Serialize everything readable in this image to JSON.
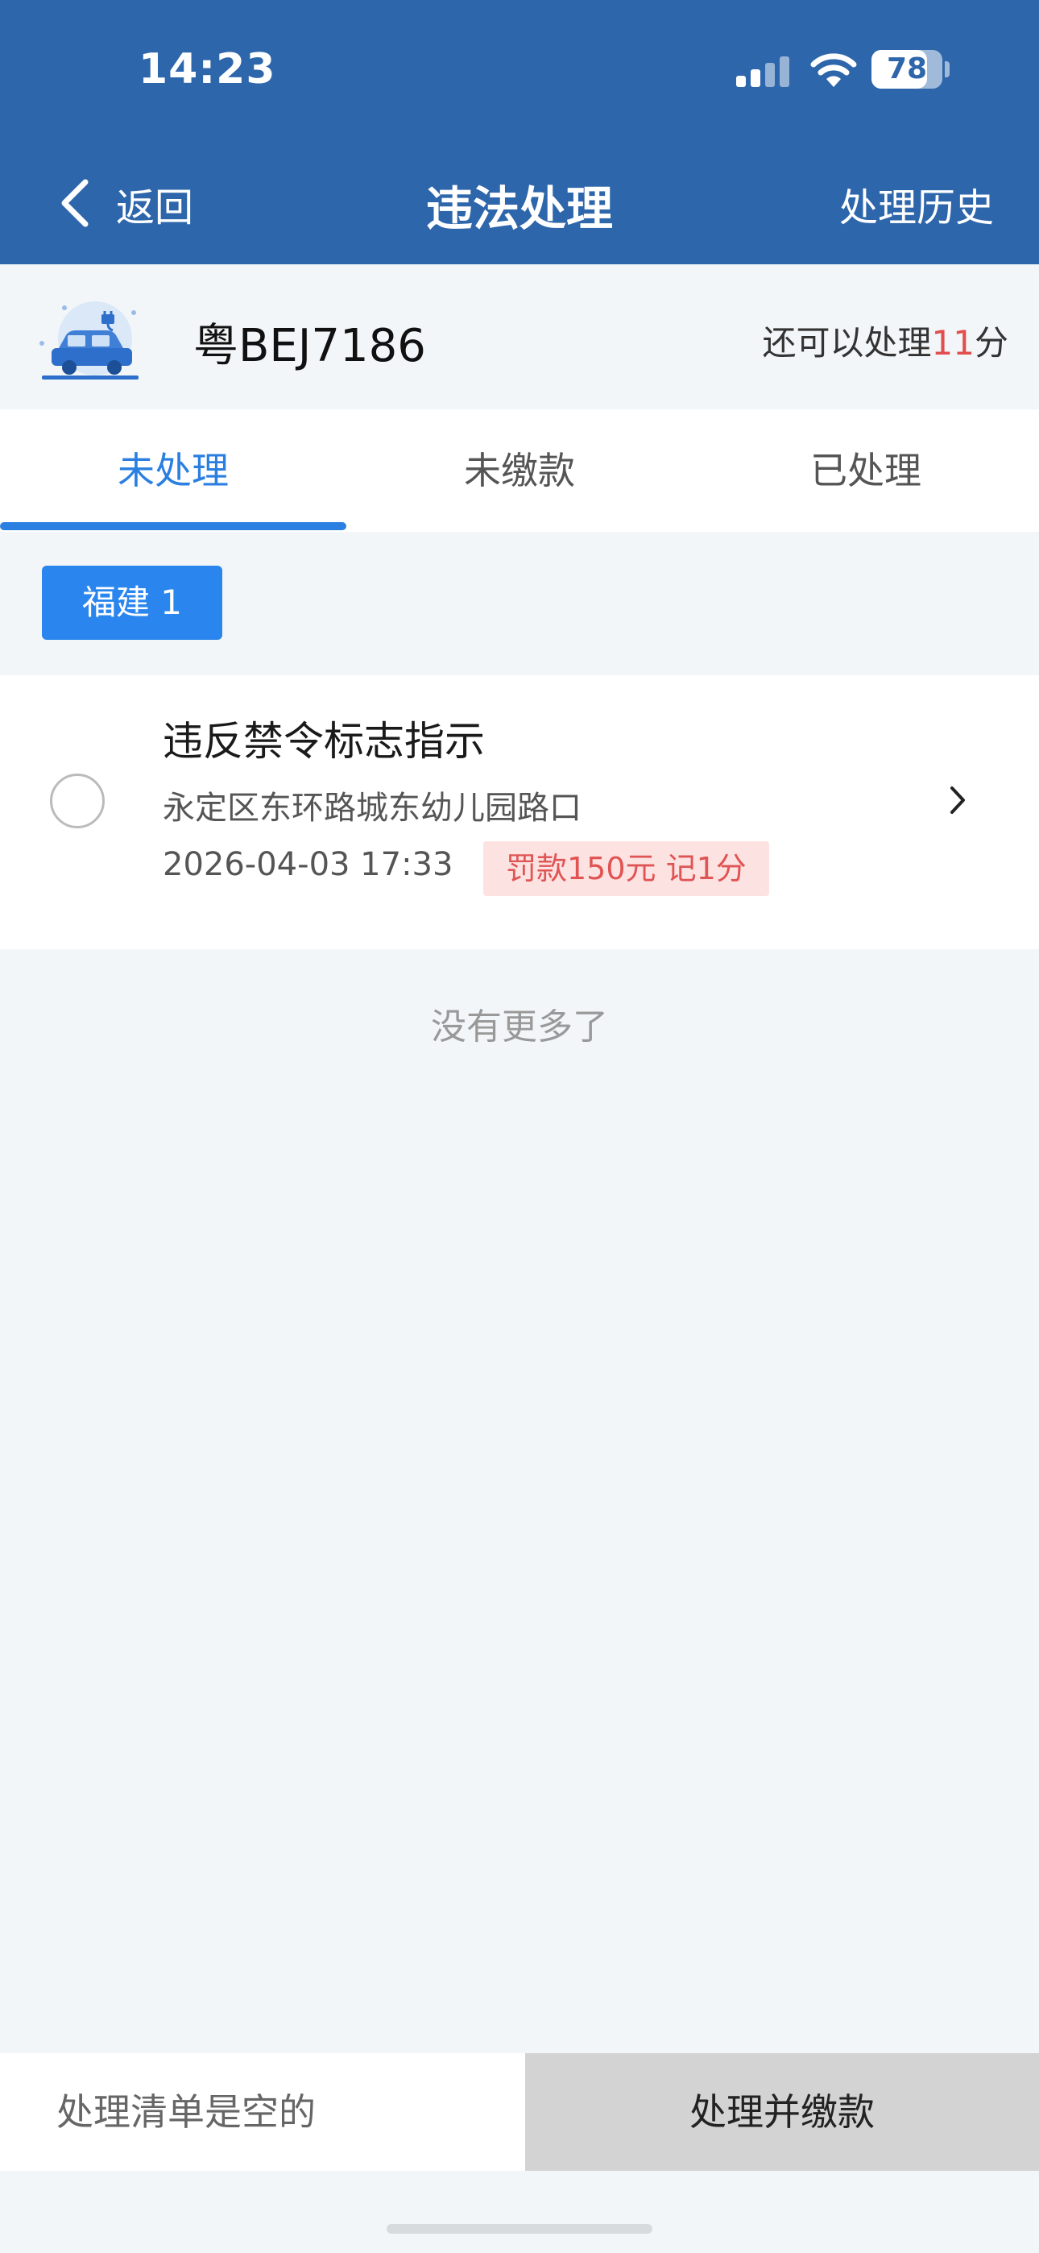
{
  "status_bar": {
    "time": "14:23",
    "battery_level": "78",
    "battery_fraction": 0.78,
    "icons": [
      "signal-icon",
      "wifi-icon",
      "battery-icon"
    ]
  },
  "nav": {
    "back_label": "返回",
    "title": "违法处理",
    "history_label": "处理历史"
  },
  "vehicle": {
    "plate": "粤BEJ7186",
    "points_prefix": "还可以处理",
    "points_value": "11",
    "points_suffix": "分"
  },
  "tabs": [
    {
      "label": "未处理",
      "active": true
    },
    {
      "label": "未缴款",
      "active": false
    },
    {
      "label": "已处理",
      "active": false
    }
  ],
  "region_filter": {
    "label": "福建 1"
  },
  "violations": [
    {
      "title": "违反禁令标志指示",
      "location": "永定区东环路城东幼儿园路口",
      "time": "2026-04-03 17:33",
      "penalty": "罚款150元 记1分"
    }
  ],
  "list_end_text": "没有更多了",
  "bottom_bar": {
    "cart_status": "处理清单是空的",
    "action_label": "处理并缴款"
  },
  "colors": {
    "header_bg": "#2e66ab",
    "accent": "#2a7fe0",
    "points_highlight": "#e24d4d",
    "penalty_badge_bg": "#fde2e2",
    "penalty_badge_text": "#e05454",
    "disabled_button_bg": "#d3d3d3"
  }
}
